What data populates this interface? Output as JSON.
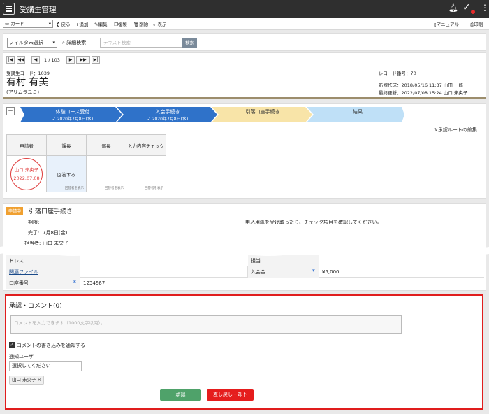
{
  "app": {
    "title": "受講生管理"
  },
  "toolbar": {
    "view_select": "カード",
    "back": "戻る",
    "add": "追加",
    "edit": "編集",
    "copy": "複製",
    "delete": "削除",
    "display": "表示",
    "manual": "マニュアル",
    "print": "印刷"
  },
  "filter": {
    "select": "フィルタ未選択",
    "detail_search": "詳細検索",
    "text_placeholder": "テキスト検索",
    "search_button": "検索"
  },
  "pager": {
    "count": "1 / 103"
  },
  "record": {
    "code": "受講生コード：1039",
    "name": "有村 有美",
    "kana": "(アリムラユミ)",
    "record_no": "レコード番号：70",
    "created": "新規作成：2018/05/16 11:37 山田 一郎",
    "updated": "最終更新：2022/07/08 15:24 山口 未央子"
  },
  "workflow": {
    "steps": [
      {
        "label": "体験コース受付",
        "date": "✓ 2020年7月8日(水)"
      },
      {
        "label": "入会手続き",
        "date": "✓ 2020年7月8日(水)"
      },
      {
        "label": "引落口座手続き",
        "date": ""
      },
      {
        "label": "結果",
        "date": ""
      }
    ],
    "route_edit": "承認ルートの編集",
    "approvers": {
      "headers": [
        "申請者",
        "課長",
        "部長",
        "入力内容チェック"
      ],
      "stamp_name": "山口 未央子",
      "stamp_date": "2022.07.08",
      "answered": "回答する",
      "note": "回答者を表示"
    }
  },
  "task": {
    "status": "申請中",
    "title": "引落口座手続き",
    "deadline_label": "期限:",
    "done_label": "完了:",
    "done_value": "7月8日(金)",
    "assignee_label": "担当者:",
    "assignee_value": "山口 未央子",
    "instruction": "申込用紙を受け取ったら、チェック項目を確認してください。"
  },
  "fields": {
    "row1_left": "ドレス",
    "row1_right": "担当",
    "files_label": "関連ファイル",
    "deposit_label": "入会金",
    "deposit_value": "¥5,000",
    "account_label": "口座番号",
    "account_value": "1234567"
  },
  "comments": {
    "title": "承認・コメント(0)",
    "placeholder": "コメントを入力できます（1000文字以内）。",
    "notify_label": "コメントの書き込みを通知する",
    "notify_user_title": "通知ユーザ",
    "user_select": "選択してください",
    "user_chip": "山口 未央子 ×",
    "approve": "承認",
    "reject": "差し戻し・却下"
  },
  "colors": {
    "step_done": "#2f72c9",
    "step_current": "#f8e4a8",
    "step_next": "#bfe0f7",
    "highlight": "#e01d1d"
  }
}
